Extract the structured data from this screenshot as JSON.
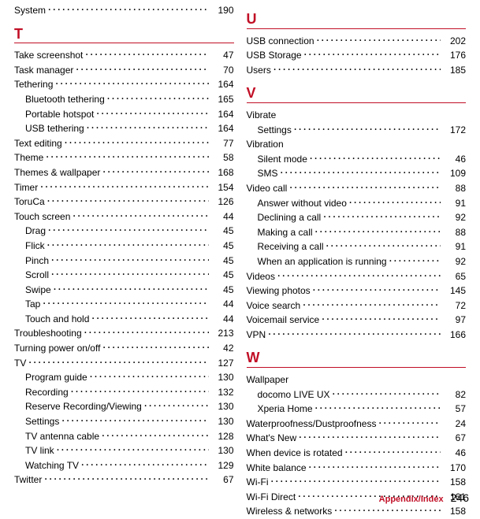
{
  "footer": {
    "label": "Appendix/Index",
    "page": "246"
  },
  "left": {
    "pre": [
      {
        "label": "System",
        "page": "190"
      }
    ],
    "sections": [
      {
        "letter": "T",
        "entries": [
          {
            "label": "Take screenshot",
            "page": "47"
          },
          {
            "label": "Task manager",
            "page": "70"
          },
          {
            "label": "Tethering",
            "page": "164"
          },
          {
            "label": "Bluetooth tethering",
            "page": "165",
            "indent": 1
          },
          {
            "label": "Portable hotspot",
            "page": "164",
            "indent": 1
          },
          {
            "label": "USB tethering",
            "page": "164",
            "indent": 1
          },
          {
            "label": "Text editing",
            "page": "77"
          },
          {
            "label": "Theme",
            "page": "58"
          },
          {
            "label": "Themes & wallpaper",
            "page": "168"
          },
          {
            "label": "Timer",
            "page": "154"
          },
          {
            "label": "ToruCa",
            "page": "126"
          },
          {
            "label": "Touch screen",
            "page": "44"
          },
          {
            "label": "Drag",
            "page": "45",
            "indent": 1
          },
          {
            "label": "Flick",
            "page": "45",
            "indent": 1
          },
          {
            "label": "Pinch",
            "page": "45",
            "indent": 1
          },
          {
            "label": "Scroll",
            "page": "45",
            "indent": 1
          },
          {
            "label": "Swipe",
            "page": "45",
            "indent": 1
          },
          {
            "label": "Tap",
            "page": "44",
            "indent": 1
          },
          {
            "label": "Touch and hold",
            "page": "44",
            "indent": 1
          },
          {
            "label": "Troubleshooting",
            "page": "213"
          },
          {
            "label": "Turning power on/off",
            "page": "42"
          },
          {
            "label": "TV",
            "page": "127"
          },
          {
            "label": "Program guide",
            "page": "130",
            "indent": 1
          },
          {
            "label": "Recording",
            "page": "132",
            "indent": 1
          },
          {
            "label": "Reserve Recording/Viewing",
            "page": "130",
            "indent": 1
          },
          {
            "label": "Settings",
            "page": "130",
            "indent": 1
          },
          {
            "label": "TV antenna cable",
            "page": "128",
            "indent": 1
          },
          {
            "label": "TV link",
            "page": "130",
            "indent": 1
          },
          {
            "label": "Watching TV",
            "page": "129",
            "indent": 1
          },
          {
            "label": "Twitter",
            "page": "67"
          }
        ]
      }
    ]
  },
  "right": {
    "sections": [
      {
        "letter": "U",
        "entries": [
          {
            "label": "USB connection",
            "page": "202"
          },
          {
            "label": "USB Storage",
            "page": "176"
          },
          {
            "label": "Users",
            "page": "185"
          }
        ]
      },
      {
        "letter": "V",
        "entries": [
          {
            "label": "Vibrate",
            "group": true
          },
          {
            "label": "Settings",
            "page": "172",
            "indent": 1
          },
          {
            "label": "Vibration",
            "group": true
          },
          {
            "label": "Silent mode",
            "page": "46",
            "indent": 1
          },
          {
            "label": "SMS",
            "page": "109",
            "indent": 1
          },
          {
            "label": "Video call",
            "page": "88"
          },
          {
            "label": "Answer without video",
            "page": "91",
            "indent": 1
          },
          {
            "label": "Declining a call",
            "page": "92",
            "indent": 1
          },
          {
            "label": "Making a call",
            "page": "88",
            "indent": 1
          },
          {
            "label": "Receiving a call",
            "page": "91",
            "indent": 1
          },
          {
            "label": "When an application is running",
            "page": "92",
            "indent": 1
          },
          {
            "label": "Videos",
            "page": "65"
          },
          {
            "label": "Viewing photos",
            "page": "145"
          },
          {
            "label": "Voice search",
            "page": "72"
          },
          {
            "label": "Voicemail service",
            "page": "97"
          },
          {
            "label": "VPN",
            "page": "166"
          }
        ]
      },
      {
        "letter": "W",
        "entries": [
          {
            "label": "Wallpaper",
            "group": true
          },
          {
            "label": "docomo LIVE UX",
            "page": "82",
            "indent": 1
          },
          {
            "label": "Xperia Home",
            "page": "57",
            "indent": 1
          },
          {
            "label": "Waterproofness/Dustproofness",
            "page": "24"
          },
          {
            "label": "What's New",
            "page": "67"
          },
          {
            "label": "When device is rotated",
            "page": "46"
          },
          {
            "label": "White balance",
            "page": "170"
          },
          {
            "label": "Wi-Fi",
            "page": "158"
          },
          {
            "label": "Wi-Fi Direct",
            "page": "161"
          },
          {
            "label": "Wireless & networks",
            "page": "158"
          }
        ]
      }
    ]
  }
}
